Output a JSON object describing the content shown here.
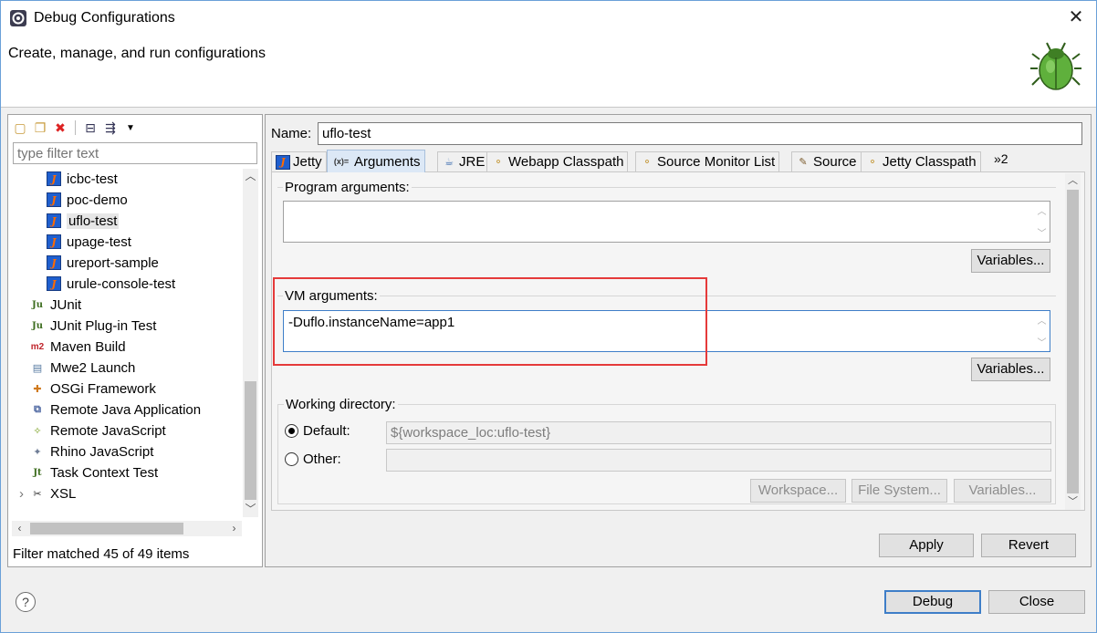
{
  "window": {
    "title": "Debug Configurations",
    "subtitle": "Create, manage, and run configurations",
    "close_glyph": "✕"
  },
  "left": {
    "toolbar": [
      {
        "icon": "new-config-icon",
        "glyph": "▢"
      },
      {
        "icon": "duplicate-icon",
        "glyph": "❐"
      },
      {
        "icon": "delete-icon",
        "glyph": "✖"
      },
      {
        "icon": "collapse-all-icon",
        "glyph": "⊟"
      },
      {
        "icon": "filter-icon",
        "glyph": "⇶"
      },
      {
        "icon": "dropdown-icon",
        "glyph": "▼"
      }
    ],
    "filter_placeholder": "type filter text",
    "tree": [
      {
        "label": "icbc-test",
        "icon": "jetty-icon",
        "indent": 2
      },
      {
        "label": "poc-demo",
        "icon": "jetty-icon",
        "indent": 2
      },
      {
        "label": "uflo-test",
        "icon": "jetty-icon",
        "indent": 2,
        "selected": true
      },
      {
        "label": "upage-test",
        "icon": "jetty-icon",
        "indent": 2
      },
      {
        "label": "ureport-sample",
        "icon": "jetty-icon",
        "indent": 2
      },
      {
        "label": "urule-console-test",
        "icon": "jetty-icon",
        "indent": 2
      },
      {
        "label": "JUnit",
        "icon": "junit-icon",
        "indent": 1
      },
      {
        "label": "JUnit Plug-in Test",
        "icon": "junit-plugin-icon",
        "indent": 1
      },
      {
        "label": "Maven Build",
        "icon": "maven-icon",
        "indent": 1
      },
      {
        "label": "Mwe2 Launch",
        "icon": "mwe2-icon",
        "indent": 1
      },
      {
        "label": "OSGi Framework",
        "icon": "osgi-icon",
        "indent": 1
      },
      {
        "label": "Remote Java Application",
        "icon": "remote-java-icon",
        "indent": 1
      },
      {
        "label": "Remote JavaScript",
        "icon": "remote-js-icon",
        "indent": 1
      },
      {
        "label": "Rhino JavaScript",
        "icon": "rhino-icon",
        "indent": 1
      },
      {
        "label": "Task Context Test",
        "icon": "task-context-icon",
        "indent": 1
      },
      {
        "label": "XSL",
        "icon": "xsl-icon",
        "indent": 1,
        "expander": "›"
      }
    ],
    "icon_glyphs": {
      "jetty-icon": "J",
      "junit-icon": "Ju",
      "junit-plugin-icon": "Ju",
      "maven-icon": "m2",
      "mwe2-icon": "▤",
      "osgi-icon": "✚",
      "remote-java-icon": "⧉",
      "remote-js-icon": "✧",
      "rhino-icon": "✦",
      "task-context-icon": "Jt",
      "xsl-icon": "✂"
    },
    "status": "Filter matched 45 of 49 items"
  },
  "right": {
    "name_label": "Name:",
    "name_value": "uflo-test",
    "tabs": [
      {
        "label": "Jetty",
        "icon": "jetty-icon",
        "glyph": "J"
      },
      {
        "label": "Arguments",
        "icon": "arguments-icon",
        "glyph": "(x)=",
        "active": true
      },
      {
        "label": "JRE",
        "icon": "jre-icon",
        "glyph": "☕"
      },
      {
        "label": "Webapp Classpath",
        "icon": "classpath-icon",
        "glyph": "⚬"
      },
      {
        "label": "Source Monitor List",
        "icon": "source-monitor-icon",
        "glyph": "⚬"
      },
      {
        "label": "Source",
        "icon": "source-icon",
        "glyph": "✎"
      },
      {
        "label": "Jetty Classpath",
        "icon": "classpath-icon",
        "glyph": "⚬"
      }
    ],
    "tabs_more": "»2",
    "program_args_label": "Program arguments:",
    "program_args_value": "",
    "vm_args_label": "VM arguments:",
    "vm_args_value": "-Duflo.instanceName=app1",
    "variables_label": "Variables...",
    "working_dir_label": "Working directory:",
    "default_label": "Default:",
    "default_value": "${workspace_loc:uflo-test}",
    "other_label": "Other:",
    "other_value": "",
    "workspace_label": "Workspace...",
    "filesystem_label": "File System...",
    "apply_label": "Apply",
    "revert_label": "Revert"
  },
  "footer": {
    "help_glyph": "?",
    "debug_label": "Debug",
    "close_label": "Close"
  },
  "colors": {
    "highlight": "#e53a3a",
    "focus": "#3e7ec8",
    "jetty_icon_bg": "#1f5fcf"
  }
}
